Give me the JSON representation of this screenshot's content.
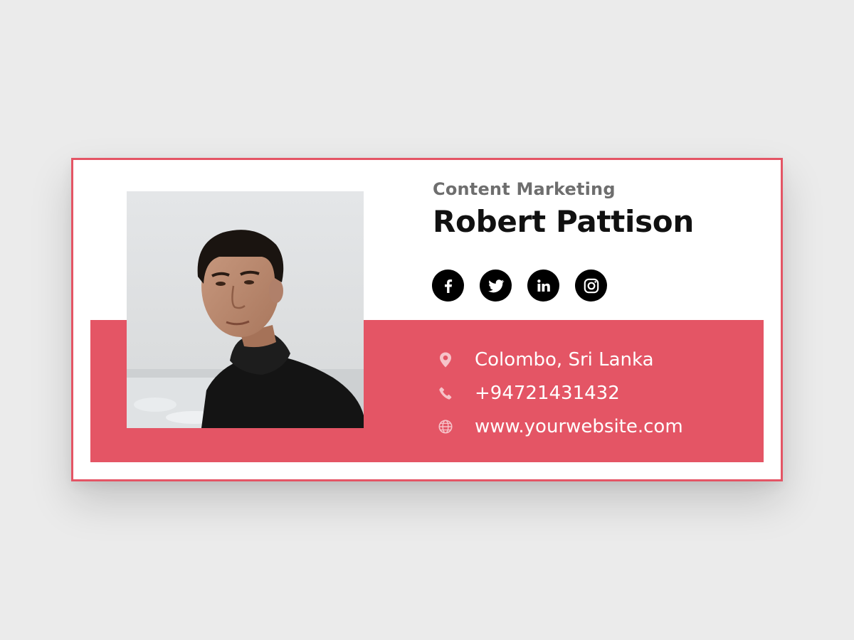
{
  "signature": {
    "role": "Content Marketing",
    "name": "Robert Pattison"
  },
  "socials": [
    {
      "icon": "facebook-icon"
    },
    {
      "icon": "twitter-icon"
    },
    {
      "icon": "linkedin-icon"
    },
    {
      "icon": "instagram-icon"
    }
  ],
  "contacts": {
    "location": "Colombo, Sri Lanka",
    "phone": "+94721431432",
    "website": "www.yourwebsite.com"
  },
  "colors": {
    "accent": "#e45565",
    "background": "#ebebeb",
    "name_text": "#111111",
    "role_text": "#6e6e6e",
    "contact_icon": "#f6c3c9"
  }
}
